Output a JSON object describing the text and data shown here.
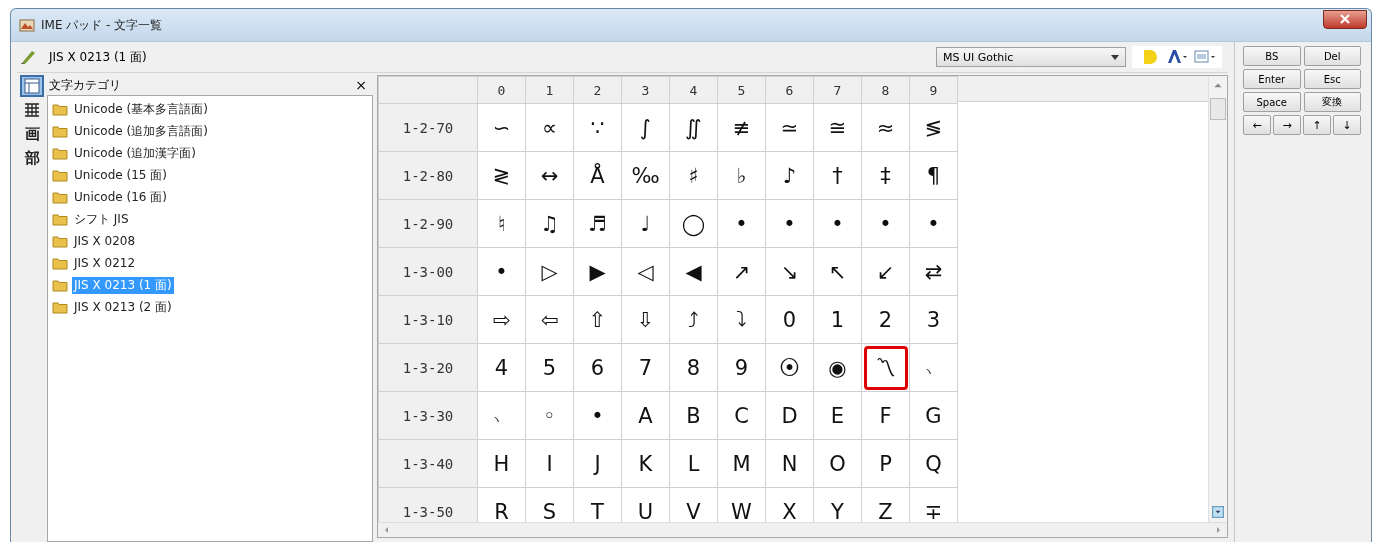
{
  "window": {
    "title": "IME パッド - 文字一覧"
  },
  "current_category": "JIS X 0213 (1 面)",
  "side_tools": [
    {
      "kind": "character-list",
      "selected": true
    },
    {
      "kind": "soft-keyboard",
      "selected": false
    },
    {
      "kind": "glyph",
      "label": "画",
      "selected": false
    },
    {
      "kind": "glyph",
      "label": "部",
      "selected": false
    }
  ],
  "category_panel": {
    "title": "文字カテゴリ",
    "close": "×"
  },
  "categories": [
    {
      "label": "Unicode (基本多言語面)",
      "selected": false
    },
    {
      "label": "Unicode (追加多言語面)",
      "selected": false
    },
    {
      "label": "Unicode (追加漢字面)",
      "selected": false
    },
    {
      "label": "Unicode (15 面)",
      "selected": false
    },
    {
      "label": "Unicode (16 面)",
      "selected": false
    },
    {
      "label": "シフト JIS",
      "selected": false
    },
    {
      "label": "JIS X 0208",
      "selected": false
    },
    {
      "label": "JIS X 0212",
      "selected": false
    },
    {
      "label": "JIS X 0213 (1 面)",
      "selected": true
    },
    {
      "label": "JIS X 0213 (2 面)",
      "selected": false
    }
  ],
  "font": {
    "value": "MS UI Gothic"
  },
  "keys": [
    {
      "label": "BS"
    },
    {
      "label": "Del"
    },
    {
      "label": "Enter"
    },
    {
      "label": "Esc"
    },
    {
      "label": "Space"
    },
    {
      "label": "変換"
    }
  ],
  "arrow_keys": [
    {
      "label": "←"
    },
    {
      "label": "→"
    },
    {
      "label": "↑"
    },
    {
      "label": "↓"
    }
  ],
  "grid": {
    "columns": [
      "0",
      "1",
      "2",
      "3",
      "4",
      "5",
      "6",
      "7",
      "8",
      "9"
    ],
    "rows": [
      {
        "label": "1-2-70",
        "cells": [
          {
            "c": "∽",
            "marked": false
          },
          {
            "c": "∝",
            "marked": false
          },
          {
            "c": "∵",
            "marked": false
          },
          {
            "c": "∫",
            "marked": false
          },
          {
            "c": "∬",
            "marked": false
          },
          {
            "c": "≢",
            "marked": false
          },
          {
            "c": "≃",
            "marked": false
          },
          {
            "c": "≅",
            "marked": false
          },
          {
            "c": "≈",
            "marked": false
          },
          {
            "c": "≶",
            "marked": false
          }
        ]
      },
      {
        "label": "1-2-80",
        "cells": [
          {
            "c": "≷",
            "marked": false
          },
          {
            "c": "↔",
            "marked": false
          },
          {
            "c": "Å",
            "marked": false
          },
          {
            "c": "‰",
            "marked": false
          },
          {
            "c": "♯",
            "marked": false
          },
          {
            "c": "♭",
            "marked": false
          },
          {
            "c": "♪",
            "marked": false
          },
          {
            "c": "†",
            "marked": false
          },
          {
            "c": "‡",
            "marked": false
          },
          {
            "c": "¶",
            "marked": false
          }
        ]
      },
      {
        "label": "1-2-90",
        "cells": [
          {
            "c": "♮",
            "marked": false
          },
          {
            "c": "♫",
            "marked": false
          },
          {
            "c": "♬",
            "marked": false
          },
          {
            "c": "♩",
            "marked": false
          },
          {
            "c": "◯",
            "marked": false
          },
          {
            "c": "•",
            "marked": false
          },
          {
            "c": "•",
            "marked": false
          },
          {
            "c": "•",
            "marked": false
          },
          {
            "c": "•",
            "marked": false
          },
          {
            "c": "•",
            "marked": false
          }
        ]
      },
      {
        "label": "1-3-00",
        "cells": [
          {
            "c": "•",
            "marked": false
          },
          {
            "c": "▷",
            "marked": false
          },
          {
            "c": "▶",
            "marked": false
          },
          {
            "c": "◁",
            "marked": false
          },
          {
            "c": "◀",
            "marked": false
          },
          {
            "c": "↗",
            "marked": false
          },
          {
            "c": "↘",
            "marked": false
          },
          {
            "c": "↖",
            "marked": false
          },
          {
            "c": "↙",
            "marked": false
          },
          {
            "c": "⇄",
            "marked": false
          }
        ]
      },
      {
        "label": "1-3-10",
        "cells": [
          {
            "c": "⇨",
            "marked": false
          },
          {
            "c": "⇦",
            "marked": false
          },
          {
            "c": "⇧",
            "marked": false
          },
          {
            "c": "⇩",
            "marked": false
          },
          {
            "c": "⤴",
            "marked": false
          },
          {
            "c": "⤵",
            "marked": false
          },
          {
            "c": "0",
            "marked": false
          },
          {
            "c": "1",
            "marked": false
          },
          {
            "c": "2",
            "marked": false
          },
          {
            "c": "3",
            "marked": false
          }
        ]
      },
      {
        "label": "1-3-20",
        "cells": [
          {
            "c": "4",
            "marked": false
          },
          {
            "c": "5",
            "marked": false
          },
          {
            "c": "6",
            "marked": false
          },
          {
            "c": "7",
            "marked": false
          },
          {
            "c": "8",
            "marked": false
          },
          {
            "c": "9",
            "marked": false
          },
          {
            "c": "⦿",
            "marked": false
          },
          {
            "c": "◉",
            "marked": false
          },
          {
            "c": "〽",
            "marked": true
          },
          {
            "c": "﹆",
            "marked": false
          }
        ]
      },
      {
        "label": "1-3-30",
        "cells": [
          {
            "c": "﹅",
            "marked": false
          },
          {
            "c": "◦",
            "marked": false
          },
          {
            "c": "•",
            "marked": false
          },
          {
            "c": "A",
            "marked": false
          },
          {
            "c": "B",
            "marked": false
          },
          {
            "c": "C",
            "marked": false
          },
          {
            "c": "D",
            "marked": false
          },
          {
            "c": "E",
            "marked": false
          },
          {
            "c": "F",
            "marked": false
          },
          {
            "c": "G",
            "marked": false
          }
        ]
      },
      {
        "label": "1-3-40",
        "cells": [
          {
            "c": "H",
            "marked": false
          },
          {
            "c": "I",
            "marked": false
          },
          {
            "c": "J",
            "marked": false
          },
          {
            "c": "K",
            "marked": false
          },
          {
            "c": "L",
            "marked": false
          },
          {
            "c": "M",
            "marked": false
          },
          {
            "c": "N",
            "marked": false
          },
          {
            "c": "O",
            "marked": false
          },
          {
            "c": "P",
            "marked": false
          },
          {
            "c": "Q",
            "marked": false
          }
        ]
      },
      {
        "label": "1-3-50",
        "cells": [
          {
            "c": "R",
            "marked": false
          },
          {
            "c": "S",
            "marked": false
          },
          {
            "c": "T",
            "marked": false
          },
          {
            "c": "U",
            "marked": false
          },
          {
            "c": "V",
            "marked": false
          },
          {
            "c": "W",
            "marked": false
          },
          {
            "c": "X",
            "marked": false
          },
          {
            "c": "Y",
            "marked": false
          },
          {
            "c": "Z",
            "marked": false
          },
          {
            "c": "∓",
            "marked": false
          }
        ]
      }
    ]
  }
}
